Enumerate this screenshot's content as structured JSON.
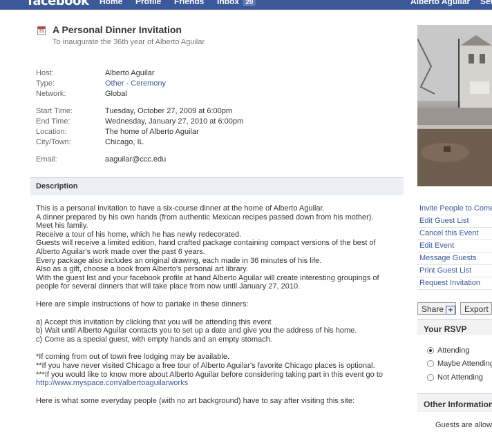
{
  "topbar": {
    "logo": "facebook",
    "nav": [
      "Home",
      "Profile",
      "Friends",
      "Inbox"
    ],
    "inbox_count": "20",
    "user_name": "Alberto Aguilar",
    "settings": "Set"
  },
  "event": {
    "calendar_day": "31",
    "title": "A Personal Dinner Invitation",
    "subtitle": "To inaugurate the 36th year of Alberto Aguilar"
  },
  "info": {
    "host_label": "Host:",
    "host": "Alberto Aguilar",
    "type_label": "Type:",
    "type_part1": "Other",
    "type_sep": " - ",
    "type_part2": "Ceremony",
    "network_label": "Network:",
    "network": "Global",
    "start_label": "Start Time:",
    "start": "Tuesday, October 27, 2009 at 6:00pm",
    "end_label": "End Time:",
    "end": "Wednesday, January 27, 2010 at 6:00pm",
    "location_label": "Location:",
    "location": "The home of Alberto Aguilar",
    "city_label": "City/Town:",
    "city": "Chicago, IL",
    "email_label": "Email:",
    "email": "aaguilar@ccc.edu"
  },
  "description": {
    "header": "Description",
    "lines": [
      "This is a personal invitation to have a six-course dinner at the home of Alberto Aguilar.",
      "A dinner prepared by his own hands (from authentic Mexican recipes passed down from his mother).",
      "Meet his family.",
      "Receive a tour of his home, which he has newly redecorated.",
      "Guests will receive a limited edition, hand crafted package containing compact versions of the best of Alberto Aguilar's work made over the past 6 years.",
      "Every package also includes an original drawing, each made in 36 minutes of his life.",
      "Also as a gift, choose a book from Alberto's personal art library.",
      "With the guest list and your facebook profile at hand Alberto Aguilar will create interesting groupings of people for several dinners that will take place from now until January 27, 2010."
    ],
    "instructions_intro": "Here are simple instructions of how to partake in these dinners:",
    "steps": [
      "a) Accept this invitation by clicking that you will be attending this event",
      "b) Wait until Alberto Aguilar contacts you to set up a date and give you the address of his home.",
      "c) Come as a special guest, with empty hands and an empty stomach."
    ],
    "note1": "*If coming from out of town free lodging may be available.",
    "note2": "**If you have never visited Chicago a free tour of Alberto Aguilar's favorite Chicago places is optional.",
    "note3": "***If you would like to know more about Alberto Aguilar before considering taking part in this event go to ",
    "note3_link": "http://www.myspace.com/albertoaguilarworks",
    "closing": "Here is what some everyday people (with no art background) have to say after visiting this site:"
  },
  "actions": [
    "Invite People to Come",
    "Edit Guest List",
    "Cancel this Event",
    "Edit Event",
    "Message Guests",
    "Print Guest List",
    "Request Invitation"
  ],
  "buttons": {
    "share": "Share",
    "export": "Export"
  },
  "rsvp": {
    "title": "Your RSVP",
    "options": [
      "Attending",
      "Maybe Attending",
      "Not Attending"
    ],
    "selected": "Attending"
  },
  "other_info": {
    "title": "Other Information",
    "text": "Guests are allowed"
  },
  "colors": {
    "brand": "#3b5998",
    "header_bg": "#eceff5"
  }
}
